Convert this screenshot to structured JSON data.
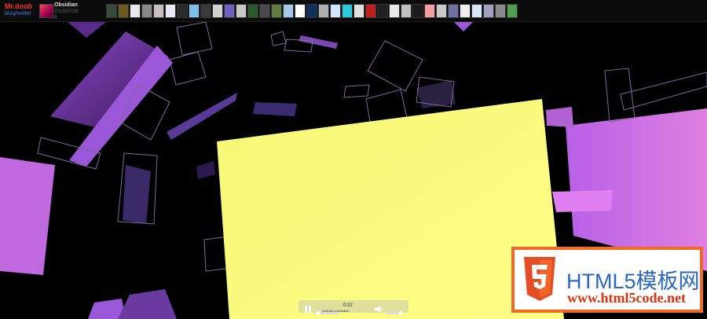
{
  "header": {
    "author": "Mr.doob",
    "author_links": "blog/twitter",
    "title": "Obsidian",
    "date": "2013/07/28",
    "count": "8"
  },
  "gallery": {
    "thumbs": [
      "#3a4a3a",
      "#6a5a20",
      "#e8e8e8",
      "#8a8a8a",
      "#c8c0c0",
      "#e8e8f8",
      "#2a2a2a",
      "#80c0e8",
      "#3a3a3a",
      "#d0d0d0",
      "#7060c0",
      "#c8c8c8",
      "#2a5a2a",
      "#4a4a4a",
      "#607a40",
      "#a8c8e8",
      "#ffffff",
      "#103060",
      "#b0b0b0",
      "#d0e8ff",
      "#30c8d8",
      "#e0e0e0",
      "#c02020",
      "#202020",
      "#e8e8e8",
      "#c0c0c0",
      "#1a1a1a",
      "#f0a0a0",
      "#c8c8c8",
      "#7070a0",
      "#f0f0f0",
      "#d8e8f8",
      "#a0a0c0",
      "#8a8a8a",
      "#50a050"
    ]
  },
  "player": {
    "time": "0:22",
    "caption": "youtube.com/watch"
  },
  "logo": {
    "line1": "HTML5模板网",
    "line2": "www.html5code.net"
  },
  "colors": {
    "accent_red": "#ff2a2a",
    "link_blue": "#3e78e8",
    "purple": "#8a48c8",
    "yellow": "#fafa80",
    "magenta": "#d070e0",
    "logo_orange": "#f06a24"
  }
}
